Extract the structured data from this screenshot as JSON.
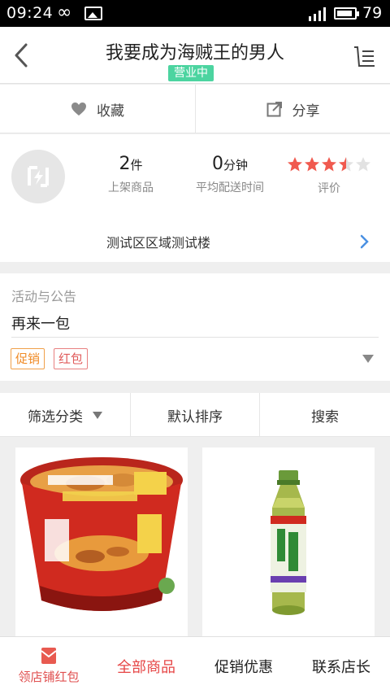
{
  "status_bar": {
    "time": "09:24",
    "battery_level": "79"
  },
  "header": {
    "title": "我要成为海贼王的男人",
    "status_badge": "营业中"
  },
  "actions": {
    "favorite_label": "收藏",
    "share_label": "分享"
  },
  "store": {
    "items_count": "2",
    "items_unit": "件",
    "items_label": "上架商品",
    "delivery_time": "0",
    "delivery_unit": "分钟",
    "delivery_label": "平均配送时间",
    "rating": 3.5,
    "rating_max": 5,
    "rating_label": "评价",
    "address": "测试区区域测试楼"
  },
  "announcement": {
    "heading": "活动与公告",
    "text": "再来一包",
    "tags": [
      "促销",
      "红包"
    ]
  },
  "filter": {
    "category": "筛选分类",
    "sort": "默认排序",
    "search": "搜索"
  },
  "products": [
    {
      "name": "",
      "image": "noodle-bowl-image"
    },
    {
      "name": "",
      "image": "green-tea-bottle-image"
    }
  ],
  "bottom_nav": {
    "redpack": "领店铺红包",
    "all_products": "全部商品",
    "promotions": "促销优惠",
    "contact": "联系店长"
  },
  "colors": {
    "accent": "#e64545",
    "badge": "#4cd4a0",
    "star": "#f05a4f",
    "link": "#4a90e2"
  }
}
